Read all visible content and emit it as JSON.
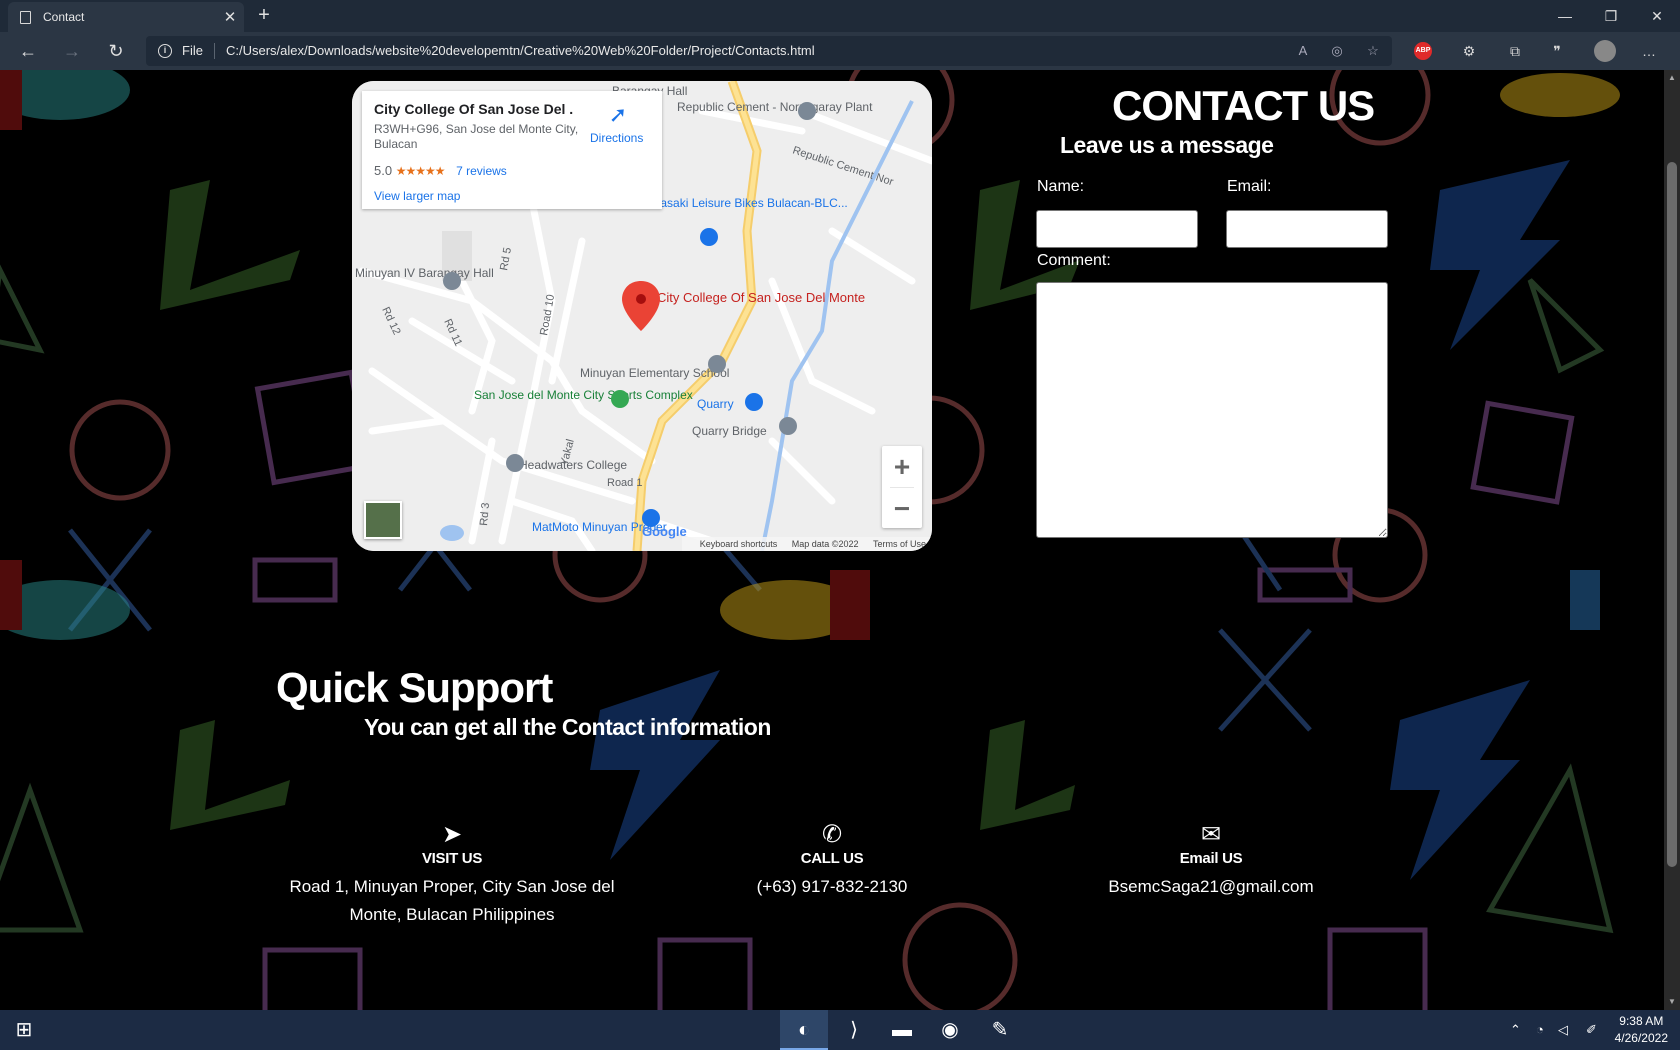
{
  "browser": {
    "tab_title": "Contact",
    "file_label": "File",
    "url": "C:/Users/alex/Downloads/website%20developemtn/Creative%20Web%20Folder/Project/Contacts.html",
    "abp_label": "ABP"
  },
  "map": {
    "place_name": "City College Of San Jose Del ...",
    "address": "R3WH+G96, San Jose del Monte City, Bulacan",
    "rating": "5.0",
    "stars": "★★★★★",
    "reviews": "7 reviews",
    "view_larger": "View larger map",
    "directions": "Directions",
    "marker_label": "City College Of San Jose Del Monte",
    "labels": [
      "Barangay Hall",
      "Republic Cement - Norzagaray Plant",
      "Republic Cement Nor",
      "Kawasaki Leisure Bikes Bulacan-BLC...",
      "Minuyan IV Barangay Hall",
      "Rd 5",
      "Road 10",
      "Rd 12",
      "Rd 11",
      "Minuyan Elementary School",
      "San Jose del Monte City Sports Complex",
      "Quarry",
      "Quarry Bridge",
      "Road 1",
      "Yakal",
      "Headwaters College",
      "MatMoto Minuyan Proper",
      "Rd 3"
    ],
    "google": "Google",
    "keyboard": "Keyboard shortcuts",
    "mapdata": "Map data ©2022",
    "terms": "Terms of Use"
  },
  "contact": {
    "title": "CONTACT US",
    "subtitle": "Leave us a message",
    "name_label": "Name:",
    "email_label": "Email:",
    "comment_label": "Comment:",
    "name_value": "",
    "email_value": "",
    "comment_value": ""
  },
  "support": {
    "title": "Quick Support",
    "subtitle": "You can get all the Contact information",
    "visit_head": "VISIT US",
    "visit_val": "Road 1, Minuyan Proper, City San Jose del Monte, Bulacan Philippines",
    "call_head": "CALL US",
    "call_val": "(+63) 917-832-2130",
    "email_head": "Email US",
    "email_val": "BsemcSaga21@gmail.com"
  },
  "taskbar": {
    "time": "9:38 AM",
    "date": "4/26/2022"
  }
}
